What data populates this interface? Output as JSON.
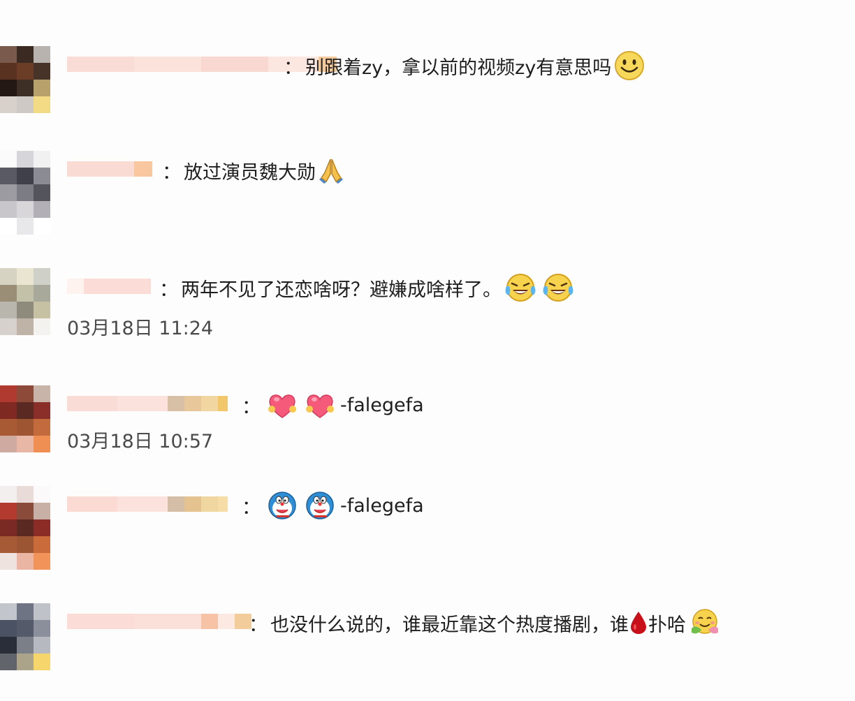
{
  "comments": [
    {
      "colon": "：",
      "text": "别跟着zy，拿以前的视频zy有意思吗",
      "emojis": [
        "smile-face-icon"
      ]
    },
    {
      "colon": "：",
      "text": "放过演员魏大勋",
      "emojis": [
        "pray-hands-icon"
      ]
    },
    {
      "colon": "：",
      "text": "两年不见了还恋啥呀？避嫌成啥样了。",
      "emojis": [
        "laugh-cry-icon",
        "laugh-cry-icon"
      ],
      "timestamp": "03月18日 11:24"
    },
    {
      "colon": "：",
      "text": "",
      "emojis": [
        "heart-hug-icon",
        "heart-hug-icon"
      ],
      "suffix": "-falegefa",
      "timestamp": "03月18日 10:57"
    },
    {
      "colon": "：",
      "text": "",
      "emojis": [
        "doraemon-icon",
        "doraemon-icon"
      ],
      "suffix": "-falegefa"
    },
    {
      "colon": "：",
      "text_before": "也没什么说的，谁最近靠这个热度播剧，谁",
      "emojis": [
        "blood-drop-icon",
        "hug-face-icon"
      ],
      "text_after": "扑哈"
    }
  ],
  "colors": {
    "background": "#fdfdfd",
    "text": "#1e1e1e",
    "timestamp": "#4a4a4a"
  }
}
